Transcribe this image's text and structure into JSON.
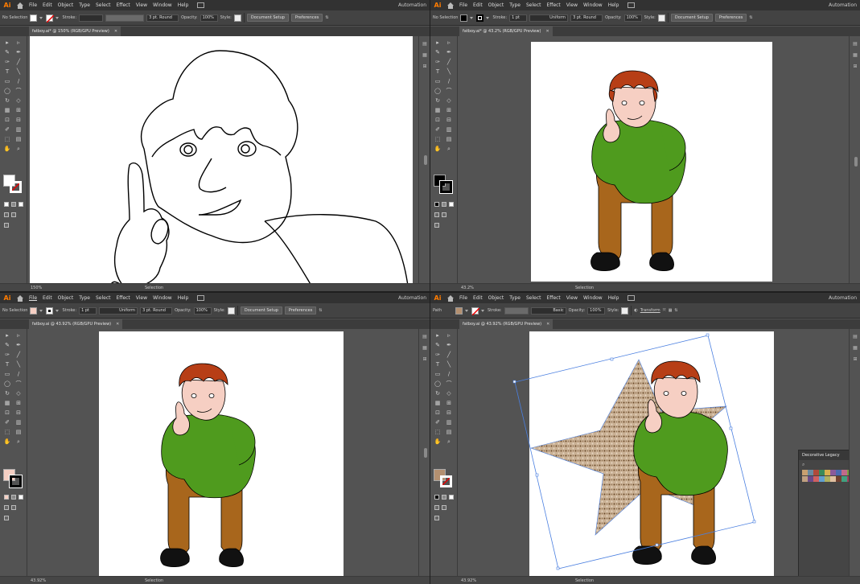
{
  "menu": [
    "File",
    "Edit",
    "Object",
    "Type",
    "Select",
    "Effect",
    "View",
    "Window",
    "Help"
  ],
  "automation_label": "Automation",
  "app_logo": "Ai",
  "quads": [
    {
      "control": {
        "selection": "No Selection",
        "stroke_label": "Stroke:",
        "stroke_weight": "",
        "profile": "",
        "brush": "3 pt. Round",
        "opacity_label": "Opacity:",
        "opacity": "100%",
        "style_label": "Style:",
        "doc_setup": "Document Setup",
        "prefs": "Preferences"
      },
      "tab": "fatboy.ai* @ 150% (RGB/GPU Preview)",
      "zoom": "150%",
      "mode": "Selection"
    },
    {
      "control": {
        "selection": "No Selection",
        "stroke_label": "Stroke:",
        "stroke_weight": "1 pt",
        "profile": "Uniform",
        "brush": "3 pt. Round",
        "opacity_label": "Opacity:",
        "opacity": "100%",
        "style_label": "Style:",
        "doc_setup": "Document Setup",
        "prefs": "Preferences"
      },
      "tab": "fatboy.ai* @ 43.2% (RGB/GPU Preview)",
      "zoom": "43.2%",
      "mode": "Selection"
    },
    {
      "control": {
        "selection": "No Selection",
        "stroke_label": "Stroke:",
        "stroke_weight": "1 pt",
        "profile": "Uniform",
        "brush": "3 pt. Round",
        "opacity_label": "Opacity:",
        "opacity": "100%",
        "style_label": "Style:",
        "doc_setup": "Document Setup",
        "prefs": "Preferences"
      },
      "tab": "fatboy.ai @ 43.92% (RGB/GPU Preview)",
      "zoom": "43.92%",
      "mode": "Selection"
    },
    {
      "control": {
        "selection": "Path",
        "stroke_label": "Stroke:",
        "stroke_weight": "",
        "profile": "Basic",
        "brush": "",
        "opacity_label": "Opacity:",
        "opacity": "100%",
        "style_label": "Style:",
        "transform": "Transform"
      },
      "tab": "fatboy.ai @ 43.92% (RGB/GPU Preview)",
      "zoom": "43.92%",
      "mode": "Selection",
      "panel": {
        "title": "Decorative Legacy"
      }
    }
  ],
  "tools": [
    "▸",
    "▹",
    "✎",
    "✒",
    "✑",
    "╱",
    "T",
    "╲",
    "▭",
    "∕",
    "◯",
    "⌒",
    "↻",
    "◇",
    "▦",
    "⊞",
    "⊡",
    "⊟",
    "✐",
    "▥",
    "⬚",
    "▤",
    "✋",
    "⌕"
  ],
  "colors": {
    "ai_orange": "#ff7c00",
    "skin": "#f6cfc3",
    "hair": "#b73e16",
    "shirt": "#4f9b1e",
    "pants": "#a8661c",
    "shoes": "#111111",
    "selection_blue": "#4a7fe0",
    "star_pattern": "#b49070"
  }
}
